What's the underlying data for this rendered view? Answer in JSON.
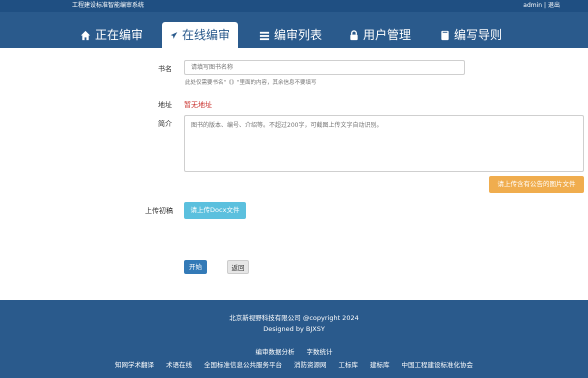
{
  "topbar": {
    "system_name": "工程建设标准智能编审系统",
    "user": "admin",
    "separator": "|",
    "logout": "退出"
  },
  "nav": {
    "tabs": [
      {
        "label": "正在编审"
      },
      {
        "label": "在线编审"
      },
      {
        "label": "编审列表"
      },
      {
        "label": "用户管理"
      },
      {
        "label": "编写导则"
      }
    ]
  },
  "form": {
    "book_label": "书名",
    "book_placeholder": "请填写图书名称",
    "book_hint": "此处仅需要书名\"《》\"里面的内容，其余信息不要填写",
    "address_label": "地址",
    "address_value": "暂无地址",
    "intro_label": "简介",
    "intro_placeholder": "图书的版本、编号、介绍等。不超过200字，可截图上传文字自动识别。",
    "upload_image_button": "请上传含有公告的图片文件",
    "upload_label": "上传初稿",
    "upload_docx_button": "请上传Docx文件",
    "start_button": "开始",
    "back_button": "返回"
  },
  "footer": {
    "copyright": "北京新视野科技有限公司 @copyright 2024",
    "designed_by": "Designed by BJXSY",
    "links_row1": [
      "编审数据分析",
      "字数统计"
    ],
    "links_row2": [
      "知网学术翻译",
      "术语在线",
      "全国标准信息公共服务平台",
      "消防资源网",
      "工标库",
      "建标库",
      "中国工程建设标准化协会"
    ]
  },
  "colors": {
    "nav_bg": "#2a5a8c",
    "topbar_bg": "#1f4f82",
    "primary": "#337ab7",
    "info": "#5bc0de",
    "warning": "#f0ad4e",
    "danger": "#c9302c"
  }
}
